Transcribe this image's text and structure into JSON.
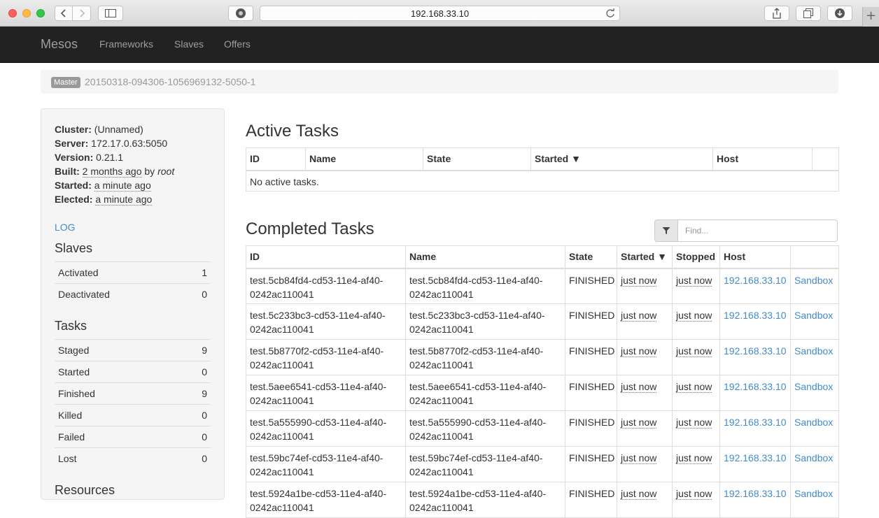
{
  "browser": {
    "url": "192.168.33.10",
    "new_tab_glyph": "+"
  },
  "navbar": {
    "brand": "Mesos",
    "links": [
      "Frameworks",
      "Slaves",
      "Offers"
    ]
  },
  "breadcrumb": {
    "label": "Master",
    "master_id": "20150318-094306-1056969132-5050-1"
  },
  "sidebar": {
    "cluster_label": "Cluster:",
    "cluster_value": "(Unnamed)",
    "server_label": "Server:",
    "server_value": "172.17.0.63:5050",
    "version_label": "Version:",
    "version_value": "0.21.1",
    "built_label": "Built:",
    "built_value": "2 months ago",
    "built_by": "by",
    "built_user": "root",
    "started_label": "Started:",
    "started_value": "a minute ago",
    "elected_label": "Elected:",
    "elected_value": "a minute ago",
    "log_link": "LOG",
    "slaves_heading": "Slaves",
    "slaves": [
      {
        "label": "Activated",
        "value": "1"
      },
      {
        "label": "Deactivated",
        "value": "0"
      }
    ],
    "tasks_heading": "Tasks",
    "tasks": [
      {
        "label": "Staged",
        "value": "9"
      },
      {
        "label": "Started",
        "value": "0"
      },
      {
        "label": "Finished",
        "value": "9"
      },
      {
        "label": "Killed",
        "value": "0"
      },
      {
        "label": "Failed",
        "value": "0"
      },
      {
        "label": "Lost",
        "value": "0"
      }
    ],
    "resources_heading": "Resources"
  },
  "active_tasks": {
    "heading": "Active Tasks",
    "columns": [
      "ID",
      "Name",
      "State",
      "Started ▼",
      "Host",
      ""
    ],
    "empty_message": "No active tasks."
  },
  "completed_tasks": {
    "heading": "Completed Tasks",
    "filter_placeholder": "Find...",
    "columns": [
      "ID",
      "Name",
      "State",
      "Started ▼",
      "Stopped",
      "Host",
      ""
    ],
    "rows": [
      {
        "id": "test.5cb84fd4-cd53-11e4-af40-0242ac110041",
        "name": "test.5cb84fd4-cd53-11e4-af40-0242ac110041",
        "state": "FINISHED",
        "started": "just now",
        "stopped": "just now",
        "host": "192.168.33.10",
        "sandbox": "Sandbox"
      },
      {
        "id": "test.5c233bc3-cd53-11e4-af40-0242ac110041",
        "name": "test.5c233bc3-cd53-11e4-af40-0242ac110041",
        "state": "FINISHED",
        "started": "just now",
        "stopped": "just now",
        "host": "192.168.33.10",
        "sandbox": "Sandbox"
      },
      {
        "id": "test.5b8770f2-cd53-11e4-af40-0242ac110041",
        "name": "test.5b8770f2-cd53-11e4-af40-0242ac110041",
        "state": "FINISHED",
        "started": "just now",
        "stopped": "just now",
        "host": "192.168.33.10",
        "sandbox": "Sandbox"
      },
      {
        "id": "test.5aee6541-cd53-11e4-af40-0242ac110041",
        "name": "test.5aee6541-cd53-11e4-af40-0242ac110041",
        "state": "FINISHED",
        "started": "just now",
        "stopped": "just now",
        "host": "192.168.33.10",
        "sandbox": "Sandbox"
      },
      {
        "id": "test.5a555990-cd53-11e4-af40-0242ac110041",
        "name": "test.5a555990-cd53-11e4-af40-0242ac110041",
        "state": "FINISHED",
        "started": "just now",
        "stopped": "just now",
        "host": "192.168.33.10",
        "sandbox": "Sandbox"
      },
      {
        "id": "test.59bc74ef-cd53-11e4-af40-0242ac110041",
        "name": "test.59bc74ef-cd53-11e4-af40-0242ac110041",
        "state": "FINISHED",
        "started": "just now",
        "stopped": "just now",
        "host": "192.168.33.10",
        "sandbox": "Sandbox"
      },
      {
        "id": "test.5924a1be-cd53-11e4-af40-0242ac110041",
        "name": "test.5924a1be-cd53-11e4-af40-0242ac110041",
        "state": "FINISHED",
        "started": "just now",
        "stopped": "just now",
        "host": "192.168.33.10",
        "sandbox": "Sandbox"
      }
    ]
  },
  "colors": {
    "navbar_bg": "#222222",
    "nav_text": "#9d9d9d",
    "link": "#428bca"
  }
}
